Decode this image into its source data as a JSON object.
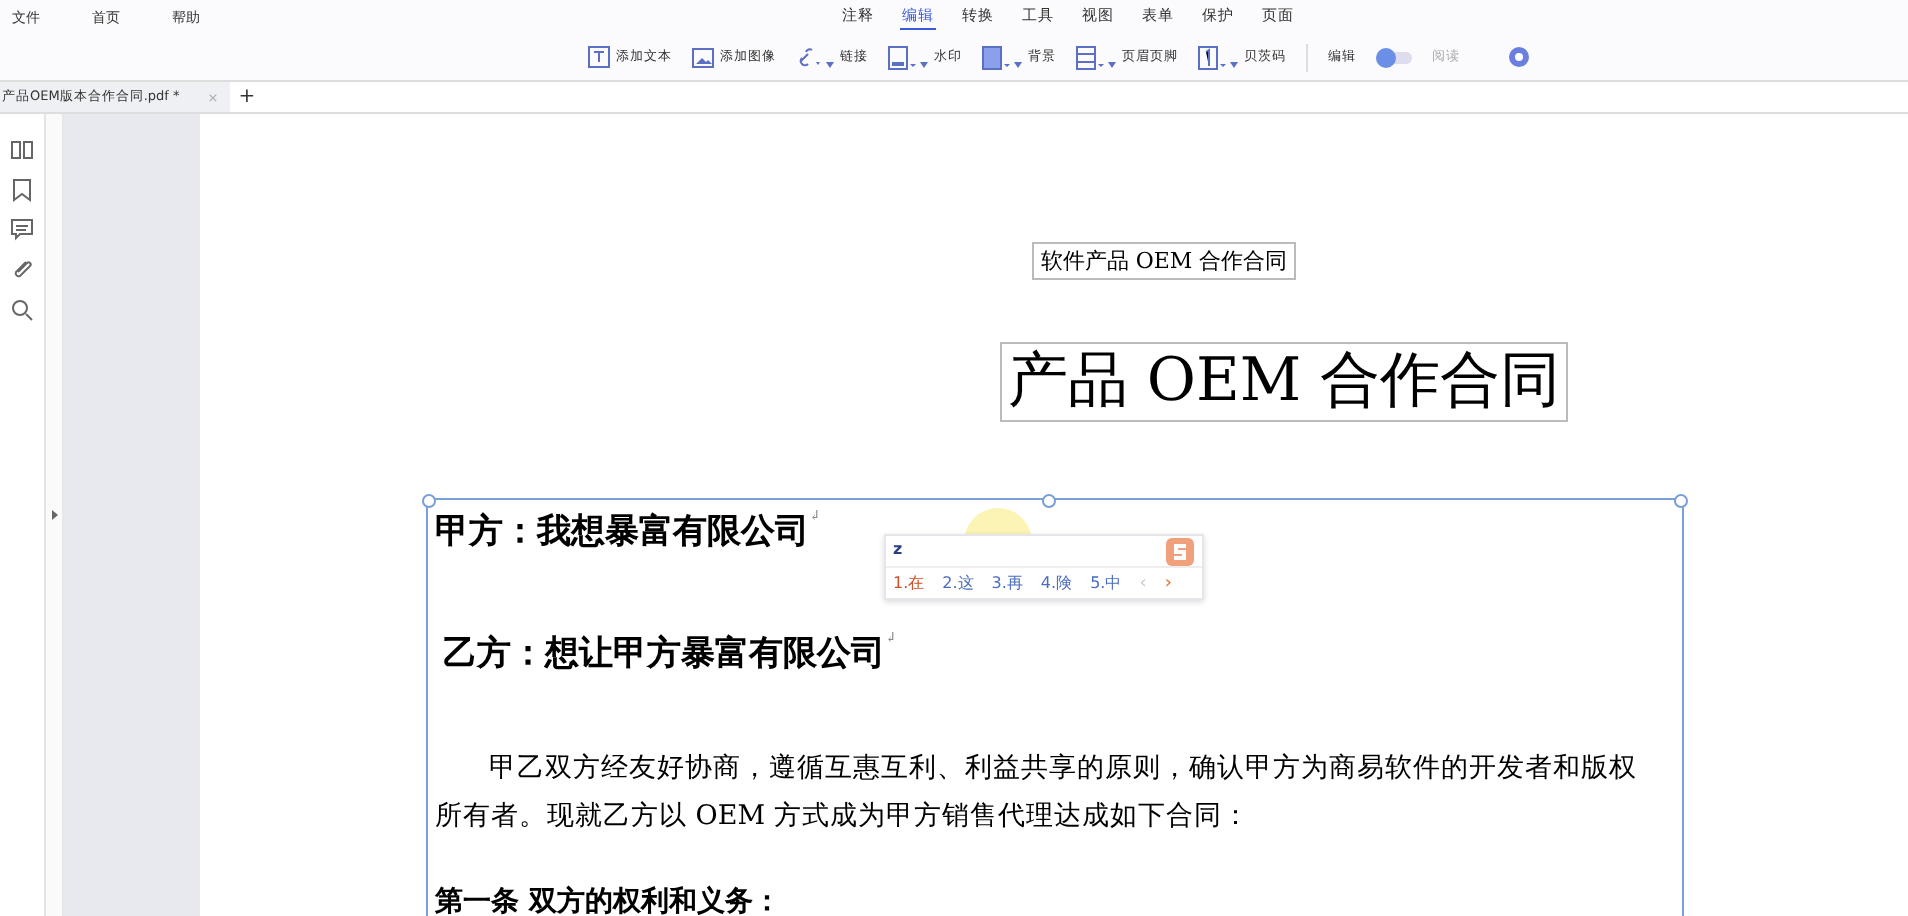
{
  "menu_left": [
    "文件",
    "首页",
    "帮助"
  ],
  "menu_tabs": [
    {
      "label": "注释",
      "selected": false
    },
    {
      "label": "编辑",
      "selected": true
    },
    {
      "label": "转换",
      "selected": false
    },
    {
      "label": "工具",
      "selected": false
    },
    {
      "label": "视图",
      "selected": false
    },
    {
      "label": "表单",
      "selected": false
    },
    {
      "label": "保护",
      "selected": false
    },
    {
      "label": "页面",
      "selected": false
    }
  ],
  "toolbar": [
    {
      "label": "添加文本",
      "kind": "text",
      "dropdown": false
    },
    {
      "label": "添加图像",
      "kind": "image",
      "dropdown": false
    },
    {
      "label": "链接",
      "kind": "link",
      "dropdown": true
    },
    {
      "label": "水印",
      "kind": "watermark",
      "dropdown": true
    },
    {
      "label": "背景",
      "kind": "background",
      "dropdown": true
    },
    {
      "label": "页眉页脚",
      "kind": "header",
      "dropdown": true
    },
    {
      "label": "贝茨码",
      "kind": "bates",
      "dropdown": true
    }
  ],
  "mode_toggle": {
    "left": "编辑",
    "right": "阅读",
    "on": false
  },
  "doc_tab": {
    "title": "产品OEM版本合作合同.pdf *",
    "close": "×",
    "add": "+"
  },
  "document": {
    "header": "软件产品 OEM 合作合同",
    "title": "产品 OEM 合作合同",
    "party_a": "甲方：我想暴富有限公司",
    "party_b": "乙方：想让甲方暴富有限公司",
    "mark": "↲",
    "paragraph": "甲乙双方经友好协商，遵循互惠互利、利益共享的原则，确认甲方为商易软件的开发者和版权所有者。现就乙方以 OEM 方式成为甲方销售代理达成如下合同：",
    "article": "第一条 双方的权利和义务："
  },
  "ime": {
    "input": "z",
    "candidates": [
      {
        "label": "1.在",
        "selected": true
      },
      {
        "label": "2.这",
        "selected": false
      },
      {
        "label": "3.再",
        "selected": false
      },
      {
        "label": "4.険",
        "selected": false
      },
      {
        "label": "5.中",
        "selected": false
      }
    ],
    "prev": "‹",
    "next": "›"
  }
}
